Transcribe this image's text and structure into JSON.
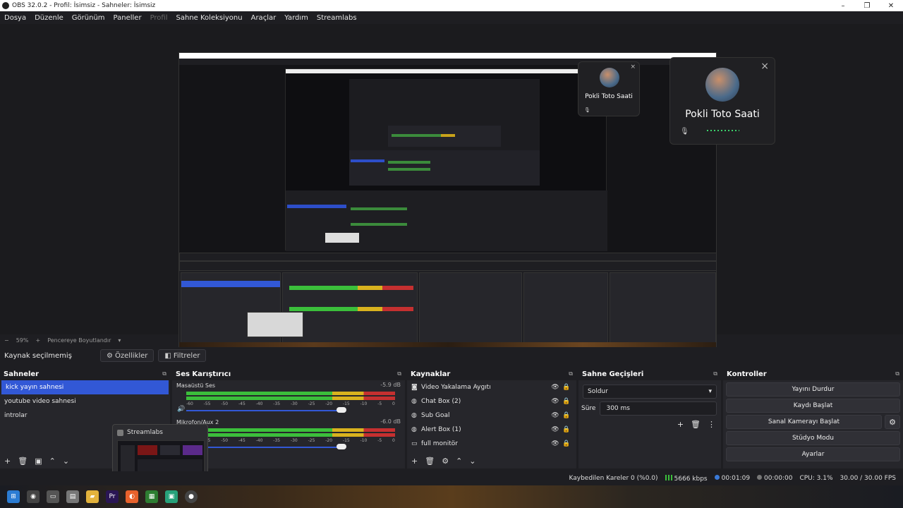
{
  "window": {
    "title": "OBS 32.0.2 - Profil: İsimsiz - Sahneler: İsimsiz",
    "min": "–",
    "max": "❐",
    "close": "✕"
  },
  "menu": {
    "items": [
      {
        "label": "Dosya"
      },
      {
        "label": "Düzenle"
      },
      {
        "label": "Görünüm"
      },
      {
        "label": "Paneller"
      },
      {
        "label": "Profil"
      },
      {
        "label": "Sahne Koleksiyonu"
      },
      {
        "label": "Araçlar"
      },
      {
        "label": "Yardım"
      },
      {
        "label": "Streamlabs"
      }
    ]
  },
  "call_large": {
    "name": "Pokli Toto Saati",
    "close": "×",
    "mic": "🎙"
  },
  "call_small": {
    "name": "Pokli Toto Saati",
    "close": "×",
    "mic": "🎙"
  },
  "zoom_bar": {
    "minus": "−",
    "zoom": "59%",
    "plus": "+",
    "mode": "Pencereye Boyutlandır",
    "caret": "▾"
  },
  "source_bar": {
    "label": "Kaynak seçilmemiş",
    "properties": "Özellikler",
    "filters": "Filtreler",
    "properties_icon": "gear-icon",
    "filters_icon": "filter-icon"
  },
  "scenes": {
    "title": "Sahneler",
    "items": [
      {
        "label": "kick yayın sahnesi"
      },
      {
        "label": "youtube video sahnesi"
      },
      {
        "label": "introlar"
      }
    ],
    "toolbar": [
      "+",
      "🗑",
      "▣",
      "⌃",
      "⌄"
    ]
  },
  "mixer": {
    "title": "Ses Karıştırıcı",
    "channels": [
      {
        "name": "Masaüstü Ses",
        "db": "-5.9 dB"
      },
      {
        "name": "Mikrofon/Aux 2",
        "db": "-6.0 dB"
      }
    ],
    "scale": [
      "-60",
      "-55",
      "-50",
      "-45",
      "-40",
      "-35",
      "-30",
      "-25",
      "-20",
      "-15",
      "-10",
      "-5",
      "0"
    ]
  },
  "sources": {
    "title": "Kaynaklar",
    "items": [
      {
        "icon": "camera-icon",
        "glyph": "◙",
        "label": "Video Yakalama Aygıtı"
      },
      {
        "icon": "globe-icon",
        "glyph": "◍",
        "label": "Chat Box (2)"
      },
      {
        "icon": "globe-icon",
        "glyph": "◍",
        "label": "Sub Goal"
      },
      {
        "icon": "globe-icon",
        "glyph": "◍",
        "label": "Alert Box (1)"
      },
      {
        "icon": "monitor-icon",
        "glyph": "▭",
        "label": "full monitör"
      }
    ],
    "toolbar": [
      "+",
      "🗑",
      "⚙",
      "⌃",
      "⌄"
    ]
  },
  "transitions": {
    "title": "Sahne Geçişleri",
    "selected": "Soldur",
    "duration_label": "Süre",
    "duration": "300 ms",
    "toolbar": [
      "+",
      "🗑",
      "⋮"
    ]
  },
  "controls": {
    "title": "Kontroller",
    "stop_stream": "Yayını Durdur",
    "start_record": "Kaydı Başlat",
    "virtual_camera": "Sanal Kamerayı Başlat",
    "studio_mode": "Stüdyo Modu",
    "settings": "Ayarlar"
  },
  "status": {
    "dropped": "Kaybedilen Kareler 0 (%0.0)",
    "bitrate": "5666 kbps",
    "stream_time": "00:01:09",
    "record_time": "00:00:00",
    "cpu": "CPU: 3.1%",
    "fps": "30.00 / 30.00 FPS"
  },
  "taskbar_popup": {
    "title": "Streamlabs"
  },
  "colors": {
    "accent": "#3258d6",
    "panel": "#26262b",
    "bg": "#1e1e22"
  }
}
